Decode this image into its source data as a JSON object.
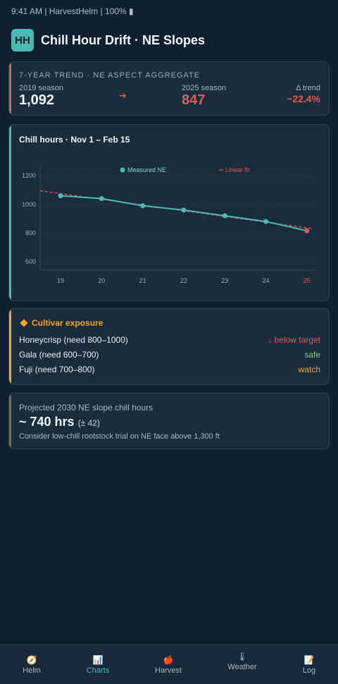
{
  "status_bar": {
    "text": "9:41 AM | HarvestHelm | 100% ▮"
  },
  "header": {
    "logo": "HH",
    "title": "Chill Hour Drift · NE Slopes"
  },
  "trend_card": {
    "caption": "7-YEAR TREND · NE ASPECT AGGREGATE",
    "season_a_label": "2019 season",
    "season_a_value": "1,092",
    "arrow": "➔",
    "season_b_label": "2025 season",
    "season_b_value": "847",
    "delta_label": "Δ trend",
    "delta_value": "−22.4%",
    "accent_color": "#e05a52"
  },
  "chart_card": {
    "title": "Chill hours · Nov 1 – Feb 15"
  },
  "chart_data": {
    "type": "line",
    "x": [
      "19",
      "20",
      "21",
      "22",
      "23",
      "24",
      "25"
    ],
    "series": [
      {
        "name": "Measured NE",
        "values": [
          1060,
          1040,
          990,
          960,
          920,
          880,
          815
        ],
        "color": "#4bbab5",
        "last_point_color": "#e05a52"
      },
      {
        "name": "Linear fit",
        "values": [
          1075,
          1035,
          995,
          955,
          915,
          875,
          835
        ],
        "color": "#e05a52",
        "style": "dashed"
      }
    ],
    "yticks": [
      600,
      800,
      1000,
      1200
    ],
    "ylim": [
      540,
      1280
    ],
    "grid": true,
    "legend": "top"
  },
  "cultivar_card": {
    "heading": "Cultivar exposure",
    "rows": [
      {
        "name": "Honeycrisp (need 800–1000)",
        "status": "↓ below target",
        "color": "#e05a52"
      },
      {
        "name": "Gala (need 600–700)",
        "status": "safe",
        "color": "#7fcf86"
      },
      {
        "name": "Fuji (need 700–800)",
        "status": "watch",
        "color": "#f5a623"
      }
    ]
  },
  "projection_card": {
    "label": "Projected 2030 NE slope chill hours",
    "value": "~ 740 hrs",
    "error": "(± 42)",
    "note": "Consider low-chill rootstock trial on NE face above 1,300 ft"
  },
  "bottom_nav": {
    "items": [
      {
        "label": "Helm",
        "icon": "🧭",
        "icon_name": "compass-icon"
      },
      {
        "label": "Charts",
        "icon": "📊",
        "icon_name": "bar-chart-icon",
        "active": true
      },
      {
        "label": "Harvest",
        "icon": "🍎",
        "icon_name": "apple-icon"
      },
      {
        "label": "Weather",
        "icon": "🌡",
        "icon_name": "thermometer-icon"
      },
      {
        "label": "Log",
        "icon": "📝",
        "icon_name": "memo-icon"
      }
    ]
  }
}
